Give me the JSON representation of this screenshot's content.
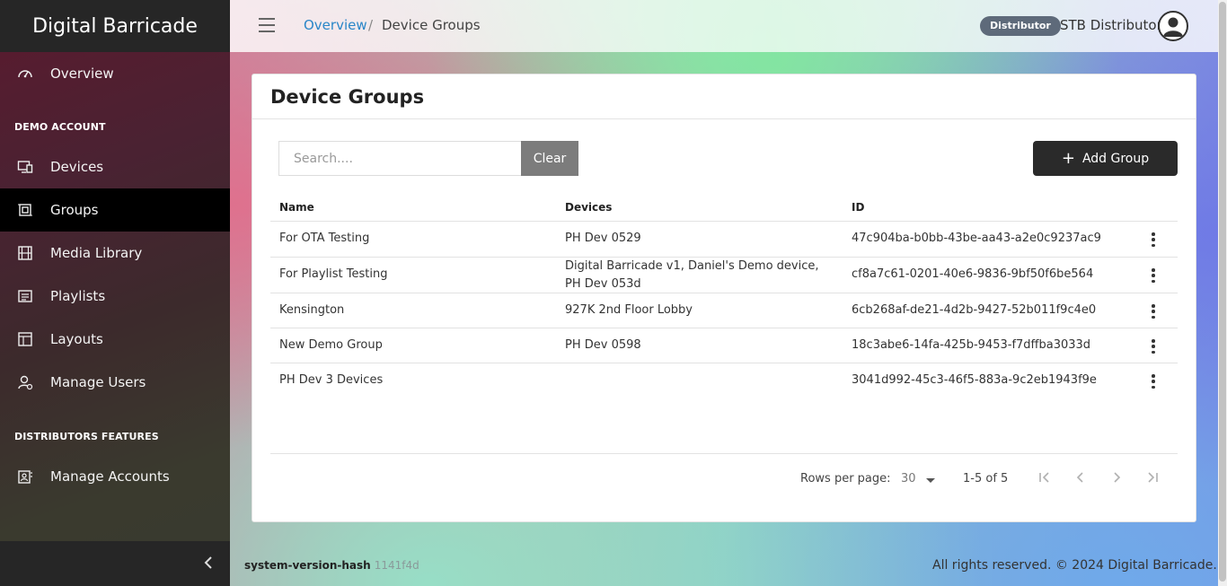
{
  "app": {
    "title": "Digital Barricade"
  },
  "sidebar": {
    "overview": {
      "label": "Overview",
      "icon": "dashboard-gauge-icon"
    },
    "section_demo": "DEMO ACCOUNT",
    "items": [
      {
        "label": "Devices",
        "icon": "devices-icon"
      },
      {
        "label": "Groups",
        "icon": "groups-icon",
        "active": true
      },
      {
        "label": "Media Library",
        "icon": "film-icon"
      },
      {
        "label": "Playlists",
        "icon": "playlist-icon"
      },
      {
        "label": "Layouts",
        "icon": "layout-icon"
      },
      {
        "label": "Manage Users",
        "icon": "users-icon"
      }
    ],
    "section_distributors": "DISTRIBUTORS FEATURES",
    "manage_accounts": {
      "label": "Manage Accounts",
      "icon": "accounts-icon"
    },
    "collapse_icon": "chevron-left-icon"
  },
  "header": {
    "breadcrumb": {
      "parent": "Overview",
      "separator": "/",
      "current": "Device Groups"
    },
    "role_badge": "Distributor",
    "username": "STB Distributor"
  },
  "card": {
    "title": "Device Groups",
    "search": {
      "placeholder": "Search....",
      "value": ""
    },
    "clear_label": "Clear",
    "add_label": "Add Group",
    "columns": {
      "name": "Name",
      "devices": "Devices",
      "id": "ID"
    },
    "rows": [
      {
        "name": "For OTA Testing",
        "devices": "PH Dev 0529",
        "id": "47c904ba-b0bb-43be-aa43-a2e0c9237ac9"
      },
      {
        "name": "For Playlist Testing",
        "devices": "Digital Barricade v1, Daniel's Demo device, PH Dev 053d",
        "id": "cf8a7c61-0201-40e6-9836-9bf50f6be564"
      },
      {
        "name": "Kensington",
        "devices": "927K 2nd Floor Lobby",
        "id": "6cb268af-de21-4d2b-9427-52b011f9c4e0"
      },
      {
        "name": "New Demo Group",
        "devices": "PH Dev 0598",
        "id": "18c3abe6-14fa-425b-9453-f7dffba3033d"
      },
      {
        "name": "PH Dev 3 Devices",
        "devices": "",
        "id": "3041d992-45c3-46f5-883a-9c2eb1943f9e"
      }
    ],
    "pagination": {
      "rows_per_page_label": "Rows per page:",
      "rows_per_page": "30",
      "range": "1-5 of 5"
    }
  },
  "footer": {
    "version_label": "system-version-hash",
    "version_hash": "1141f4d",
    "copyright": "All rights reserved. © 2024 Digital Barricade."
  },
  "colors": {
    "accent_link": "#2a86c8",
    "active_nav": "#000000",
    "primary_button": "#2a2a2a"
  }
}
